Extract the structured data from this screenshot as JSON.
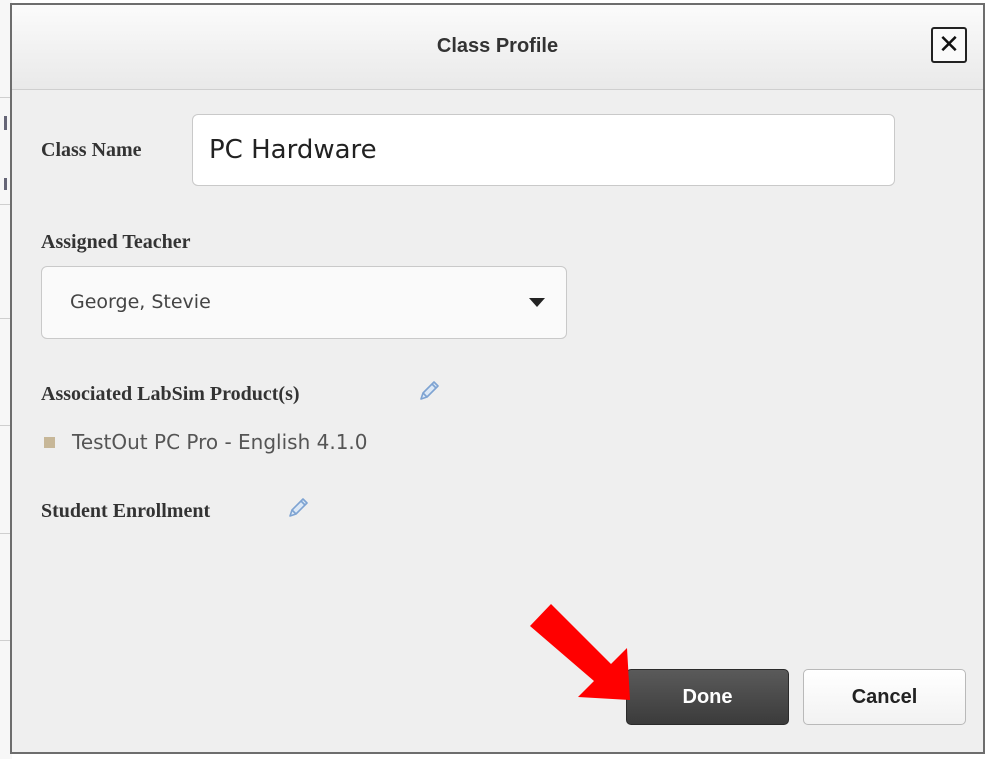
{
  "dialog": {
    "title": "Class Profile",
    "close_label": "✕"
  },
  "form": {
    "class_name_label": "Class Name",
    "class_name_value": "PC Hardware",
    "teacher_label": "Assigned Teacher",
    "teacher_selected": "George, Stevie",
    "products_label": "Associated LabSim Product(s)",
    "products": [
      "TestOut PC Pro - English 4.1.0"
    ],
    "enrollment_label": "Student Enrollment"
  },
  "buttons": {
    "done_label": "Done",
    "cancel_label": "Cancel"
  },
  "colors": {
    "done_button": "#444444",
    "pencil_icon": "#8fb0d8",
    "bullet": "#c7b798",
    "annotation_arrow": "#ff0000"
  }
}
